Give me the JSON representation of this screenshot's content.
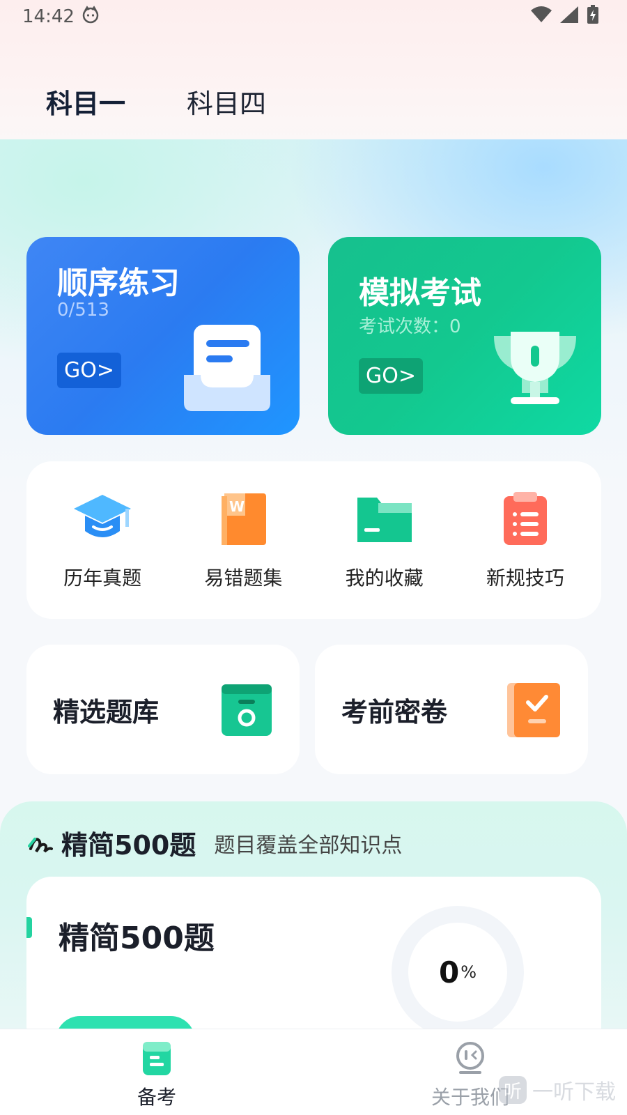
{
  "status_bar": {
    "time": "14:42"
  },
  "tabs": [
    {
      "label": "科目一",
      "active": true
    },
    {
      "label": "科目四",
      "active": false
    }
  ],
  "cards": {
    "practice": {
      "title": "顺序练习",
      "progress": "0/513",
      "go": "GO>"
    },
    "exam": {
      "title": "模拟考试",
      "count": "考试次数：0",
      "go": "GO>"
    }
  },
  "grid": [
    {
      "label": "历年真题",
      "icon": "graduation-cap-icon"
    },
    {
      "label": "易错题集",
      "icon": "book-icon"
    },
    {
      "label": "我的收藏",
      "icon": "folder-icon"
    },
    {
      "label": "新规技巧",
      "icon": "clipboard-icon"
    }
  ],
  "halves": {
    "left": {
      "title": "精选题库",
      "icon": "question-bank-icon"
    },
    "right": {
      "title": "考前密卷",
      "icon": "secret-paper-icon"
    }
  },
  "section": {
    "title": "精简500题",
    "subtitle": "题目覆盖全部知识点",
    "card_title": "精简500题",
    "progress_value": "0",
    "progress_unit": "%"
  },
  "nav": [
    {
      "label": "备考",
      "active": true
    },
    {
      "label": "关于我们",
      "active": false
    }
  ],
  "watermark": {
    "badge": "听",
    "text": "一听下载"
  },
  "colors": {
    "blue_card": "#2b7bf1",
    "green_card": "#13c88f",
    "accent": "#24d3a0"
  }
}
